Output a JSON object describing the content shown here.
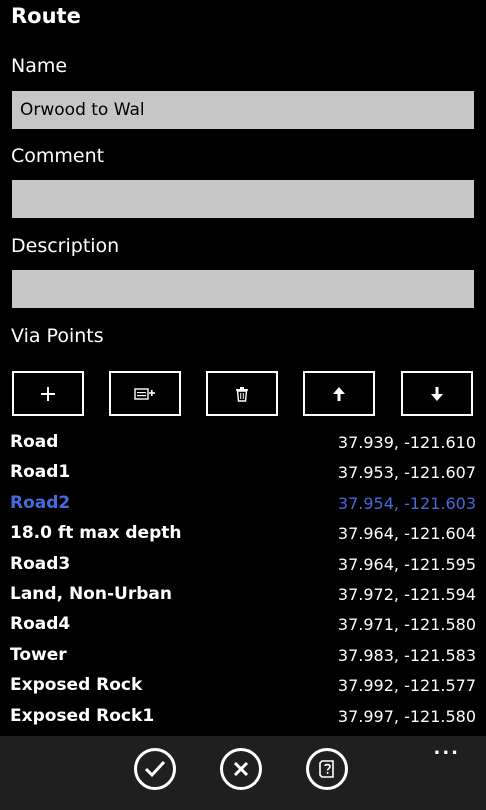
{
  "page": {
    "title": "Route"
  },
  "form": {
    "name_label": "Name",
    "name_value": "Orwood to Wal",
    "comment_label": "Comment",
    "comment_value": "",
    "description_label": "Description",
    "description_value": ""
  },
  "via_points": {
    "label": "Via Points",
    "toolbar": {
      "add_icon": "plus-icon",
      "add_from_list_icon": "list-add-icon",
      "delete_icon": "trash-icon",
      "move_up_icon": "arrow-up-icon",
      "move_down_icon": "arrow-down-icon"
    },
    "selected_color": "#4669e0",
    "items": [
      {
        "name": "Road",
        "coords": "37.939, -121.610"
      },
      {
        "name": "Road1",
        "coords": "37.953, -121.607"
      },
      {
        "name": "Road2",
        "coords": "37.954, -121.603",
        "selected": true
      },
      {
        "name": "18.0 ft max depth",
        "coords": "37.964, -121.604"
      },
      {
        "name": "Road3",
        "coords": "37.964, -121.595"
      },
      {
        "name": "Land, Non-Urban",
        "coords": "37.972, -121.594"
      },
      {
        "name": "Road4",
        "coords": "37.971, -121.580"
      },
      {
        "name": "Tower",
        "coords": "37.983, -121.583"
      },
      {
        "name": "Exposed Rock",
        "coords": "37.992, -121.577"
      },
      {
        "name": "Exposed Rock1",
        "coords": "37.997, -121.580"
      }
    ]
  },
  "app_bar": {
    "ok_icon": "checkmark-icon",
    "cancel_icon": "close-icon",
    "help_icon": "help-book-icon",
    "more": "..."
  }
}
